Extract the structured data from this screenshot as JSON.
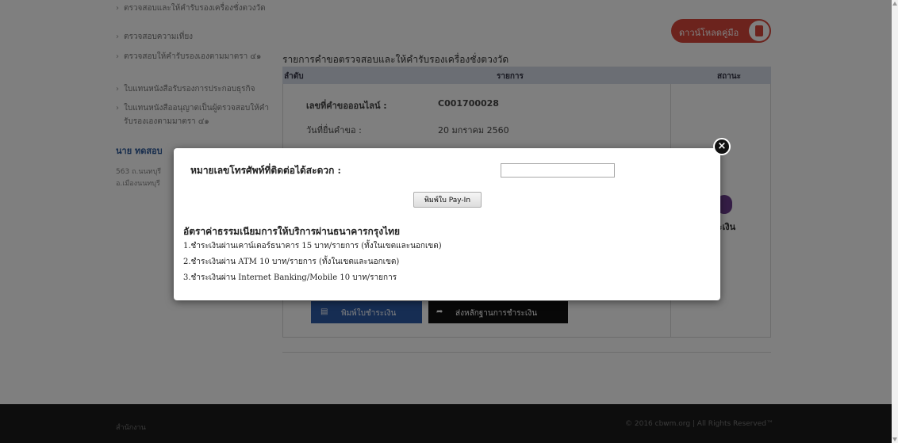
{
  "sidebar": {
    "items": [
      {
        "label": "ตรวจสอบและให้คำรับรองเครื่องชั่งตวงวัด"
      },
      {
        "label": "ตรวจสอบความเที่ยง"
      },
      {
        "label": "ตรวจสอบให้คำรับรองเองตามมาตรา ๔๑"
      },
      {
        "label": "ใบแทนหนังสือรับรองการประกอบธุรกิจ"
      },
      {
        "label": "ใบแทนหนังสืออนุญาตเป็นผู้ตรวจสอบให้คำรับรองเองตามมาตรา ๔๑"
      }
    ],
    "user_name": "นาย ทดสอบ",
    "address_line1": "563 ถ.นนทบุรี",
    "address_line2": "อ.เมืองนนทบุรี"
  },
  "content": {
    "download_label": "ดาวน์โหลดคู่มือ",
    "section_title": "รายการคำขอตรวจสอบและให้คำรับรองเครื่องชั่งตวงวัด",
    "table_headers": {
      "no": "ลำดับ",
      "item": "รายการ",
      "status": "สถานะ"
    },
    "request_no_label": "เลขที่คำขอออนไลน์ :",
    "request_no_value": "C001700028",
    "submit_date_label": "วันที่ยื่นคำขอ :",
    "submit_date_value": "20 มกราคม 2560",
    "status_text": "ชำระเงิน",
    "print_payment_label": "พิมพ์ใบชำระเงิน",
    "send_evidence_label": "ส่งหลักฐานการชำระเงิน"
  },
  "footer": {
    "left": "สำนักงาน",
    "right": "© 2016 cbwm.org | All Rights Reserved™"
  },
  "modal": {
    "close_symbol": "×",
    "phone_label": "หมายเลขโทรศัพท์ที่ติดต่อได้สะดวก :",
    "phone_value": "",
    "payin_button": "พิมพ์ใบ Pay-In",
    "fee_title": "อัตราค่าธรรมเนียมการให้บริการผ่านธนาคารกรุงไทย",
    "fee_lines": [
      "1.ชำระเงินผ่านเคาน์เตอร์ธนาคาร 15 บาท/รายการ (ทั้งในเขตและนอกเขต)",
      "2.ชำระเงินผ่าน ATM 10 บาท/รายการ (ทั้งในเขตและนอกเขต)",
      "3.ชำระเงินผ่าน Internet Banking/Mobile 10 บาท/รายการ"
    ]
  },
  "colors": {
    "overlay": "#000000",
    "download_button": "#d9473a",
    "print_button": "#2d5aa6",
    "send_button": "#111111",
    "table_header": "#d6dde8"
  }
}
